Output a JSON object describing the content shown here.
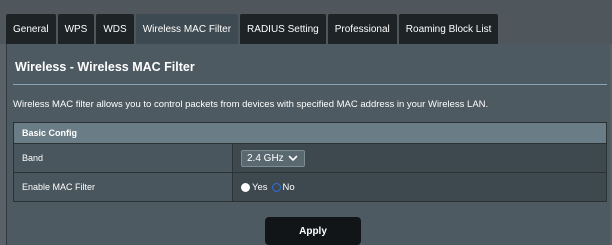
{
  "tabs": [
    {
      "label": "General"
    },
    {
      "label": "WPS"
    },
    {
      "label": "WDS"
    },
    {
      "label": "Wireless MAC Filter",
      "active": true
    },
    {
      "label": "RADIUS Setting"
    },
    {
      "label": "Professional"
    },
    {
      "label": "Roaming Block List"
    }
  ],
  "page": {
    "title": "Wireless - Wireless MAC Filter",
    "description": "Wireless MAC filter allows you to control packets from devices with specified MAC address in your Wireless LAN."
  },
  "config": {
    "section_title": "Basic Config",
    "band": {
      "label": "Band",
      "value": "2.4 GHz"
    },
    "mac_filter": {
      "label": "Enable MAC Filter",
      "options": [
        {
          "label": "Yes",
          "selected": true
        },
        {
          "label": "No",
          "selected": false
        }
      ]
    }
  },
  "apply_label": "Apply",
  "colors": {
    "accent": "#2d6fd6",
    "background": "#4d5a61"
  }
}
